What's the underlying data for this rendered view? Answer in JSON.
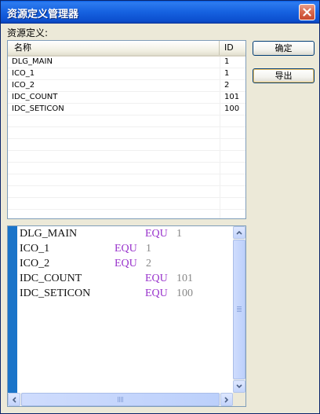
{
  "window": {
    "title": "资源定义管理器"
  },
  "section": {
    "label": "资源定义:"
  },
  "table": {
    "columns": [
      "名称",
      "ID"
    ],
    "rows": [
      {
        "name": "DLG_MAIN",
        "id": "1"
      },
      {
        "name": "ICO_1",
        "id": "1"
      },
      {
        "name": "ICO_2",
        "id": "2"
      },
      {
        "name": "IDC_COUNT",
        "id": "101"
      },
      {
        "name": "IDC_SETICON",
        "id": "100"
      }
    ]
  },
  "buttons": {
    "ok": "确定",
    "export": "导出"
  },
  "editor": {
    "lines": [
      {
        "ident": "DLG_MAIN",
        "keyword": "EQU",
        "value": "1"
      },
      {
        "ident": "ICO_1",
        "keyword": "EQU",
        "value": "1"
      },
      {
        "ident": "ICO_2",
        "keyword": "EQU",
        "value": "2"
      },
      {
        "ident": "IDC_COUNT",
        "keyword": "EQU",
        "value": "101"
      },
      {
        "ident": "IDC_SETICON",
        "keyword": "EQU",
        "value": "100"
      }
    ]
  },
  "icons": {
    "close": "close-icon",
    "scroll_up": "arrow-up-icon",
    "scroll_down": "arrow-down-icon",
    "scroll_left": "arrow-left-icon",
    "scroll_right": "arrow-right-icon"
  },
  "colors": {
    "gutter": "#1a74c9",
    "keyword": "#9933cc",
    "value": "#888888"
  }
}
